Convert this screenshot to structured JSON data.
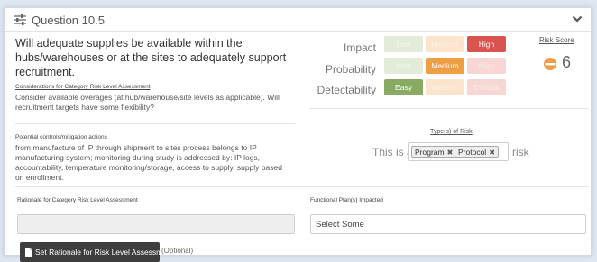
{
  "header": {
    "title": "Question 10.5",
    "icon": "sliders-icon",
    "toggle_icon": "chevron-down-icon"
  },
  "question_text": "Will adequate supplies be available within the hubs/warehouses or at the sites to adequately support recruitment.",
  "considerations": {
    "label": "Considerations for Category Risk Level Assessment",
    "text": "Consider available overages (at hub/warehouse/site levels as applicable). Will recruitment targets have some flexibility?"
  },
  "controls": {
    "label": "Potential controls/mitigation actions",
    "text": "from manufacture of IP through shipment to sites process belongs to IP manufacturing system; monitoring during study is addressed by: IP logs, accountability, temperature monitoring/storage, access to supply, supply based on enrollment."
  },
  "assessment": {
    "impact": {
      "label": "Impact",
      "options": [
        "Low",
        "Medium",
        "High"
      ],
      "selected": "High"
    },
    "probability": {
      "label": "Probability",
      "options": [
        "Low",
        "Medium",
        "High"
      ],
      "selected": "Medium"
    },
    "detectability": {
      "label": "Detectability",
      "options": [
        "Easy",
        "Medium",
        "Difficult"
      ],
      "selected": "Easy"
    }
  },
  "risk_score": {
    "label": "Risk Score",
    "value": "6",
    "icon": "half-circle-orange-icon"
  },
  "type_of_risk": {
    "label": "Type(s) of Risk",
    "prefix": "This is a",
    "tags": [
      "Program",
      "Protocol"
    ],
    "suffix": "risk"
  },
  "rationale": {
    "label": "Rationale for Category Risk Level Assessment",
    "value": ""
  },
  "functional_plans": {
    "label": "Functional Plan(s) Impacted",
    "placeholder": "Select Some"
  },
  "set_rationale_button": {
    "label": "Set Rationale for Risk Level Assessment",
    "optional": "(Optional)"
  },
  "colors": {
    "high_active": "#d9534f",
    "medium_active": "#ef9e45",
    "easy_active": "#89aa62",
    "score_orange": "#ef9e45"
  }
}
